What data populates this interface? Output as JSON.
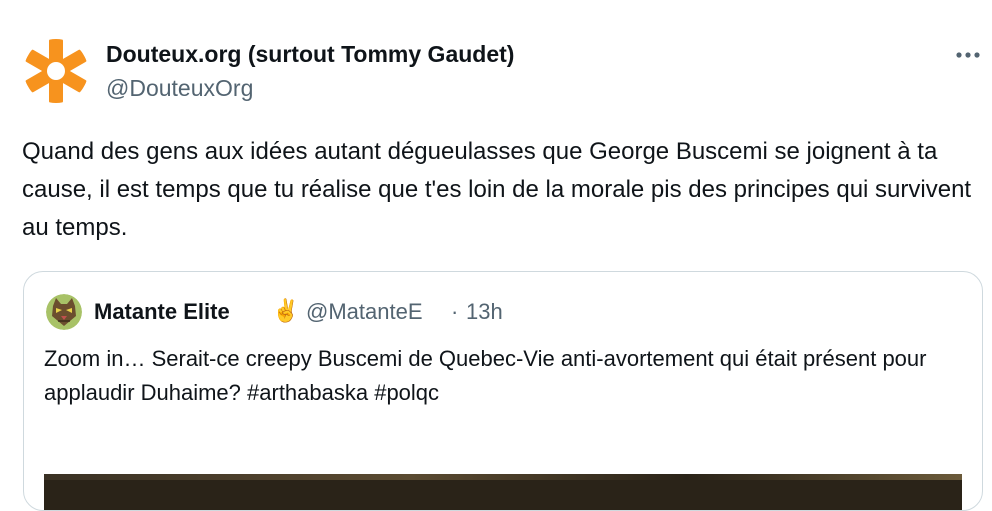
{
  "tweet": {
    "author": {
      "name": "Douteux.org (surtout Tommy Gaudet)",
      "handle": "@DouteuxOrg",
      "avatar_icon": "orange-asterisk-logo-icon"
    },
    "more_icon": "more-horizontal-icon",
    "text": "Quand des gens aux idées autant dégueulasses que George Buscemi se joignent à ta cause, il est temps que tu réalise que t'es loin de la morale pis des principes qui survivent au temps."
  },
  "quote": {
    "author": {
      "name": "Matante Elite",
      "emoji": "✌️",
      "handle": "@MatanteE",
      "separator": "·",
      "time": "13h",
      "avatar_icon": "cat-avatar-icon"
    },
    "text": "Zoom in… Serait-ce creepy Buscemi de Quebec-Vie anti-avortement qui était présent pour applaudir Duhaime? #arthabaska #polqc"
  },
  "colors": {
    "text_primary": "#0f1419",
    "text_secondary": "#536471",
    "border": "#cfd9de",
    "avatar_orange": "#f7931e"
  }
}
